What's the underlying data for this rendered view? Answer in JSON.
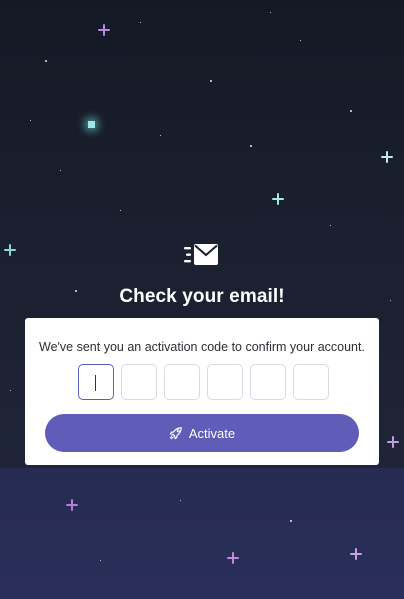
{
  "header": {
    "icon": "envelope-fast-icon",
    "title": "Check your email!"
  },
  "card": {
    "message": "We've sent you an activation code to confirm your account.",
    "code_fields": [
      {
        "value": "",
        "focused": true
      },
      {
        "value": "",
        "focused": false
      },
      {
        "value": "",
        "focused": false
      },
      {
        "value": "",
        "focused": false
      },
      {
        "value": "",
        "focused": false
      },
      {
        "value": "",
        "focused": false
      }
    ],
    "button": {
      "icon": "rocket-icon",
      "label": "Activate"
    }
  },
  "colors": {
    "background": "#1a1f2e",
    "accent": "#5f5db8",
    "card": "#ffffff"
  }
}
